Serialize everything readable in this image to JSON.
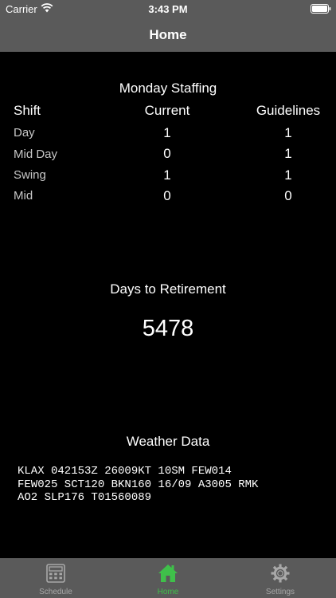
{
  "status_bar": {
    "carrier": "Carrier",
    "time": "3:43 PM"
  },
  "nav": {
    "title": "Home"
  },
  "staffing": {
    "title": "Monday Staffing",
    "headers": {
      "shift": "Shift",
      "current": "Current",
      "guidelines": "Guidelines"
    },
    "rows": [
      {
        "shift": "Day",
        "current": "1",
        "guidelines": "1"
      },
      {
        "shift": "Mid Day",
        "current": "0",
        "guidelines": "1"
      },
      {
        "shift": "Swing",
        "current": "1",
        "guidelines": "1"
      },
      {
        "shift": "Mid",
        "current": "0",
        "guidelines": "0"
      }
    ]
  },
  "retirement": {
    "title": "Days to Retirement",
    "value": "5478"
  },
  "weather": {
    "title": "Weather Data",
    "text": "KLAX 042153Z 26009KT 10SM FEW014\nFEW025 SCT120 BKN160 16/09 A3005 RMK\nAO2 SLP176 T01560089"
  },
  "tabs": [
    {
      "label": "Schedule",
      "icon": "calculator-icon",
      "active": false
    },
    {
      "label": "Home",
      "icon": "home-icon",
      "active": true
    },
    {
      "label": "Settings",
      "icon": "gear-icon",
      "active": false
    }
  ],
  "colors": {
    "active_tab": "#3fc04a",
    "inactive_tab": "#a8a8a8",
    "bar_background": "#5a5a5a"
  }
}
